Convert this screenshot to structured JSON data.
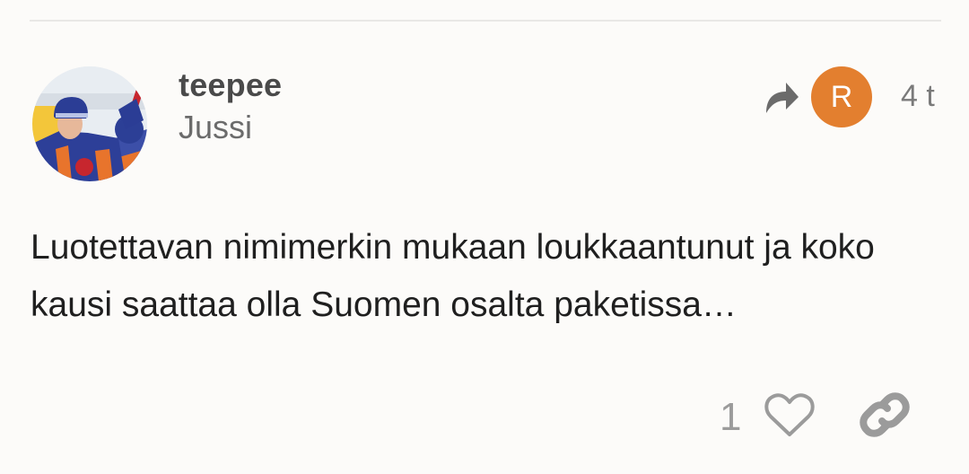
{
  "post": {
    "username": "teepee",
    "full_name": "Jussi",
    "reply_to_avatar_letter": "R",
    "reply_to_avatar_color": "#e37f2f",
    "date": "4 t",
    "body": "Luotettavan nimimerkin mukaan loukkaantunut ja koko kausi saattaa olla Suomen osalta paketissa…",
    "like_count": "1"
  },
  "icons": {
    "reply": "reply-arrow-icon",
    "like": "heart-icon",
    "share": "link-icon"
  }
}
